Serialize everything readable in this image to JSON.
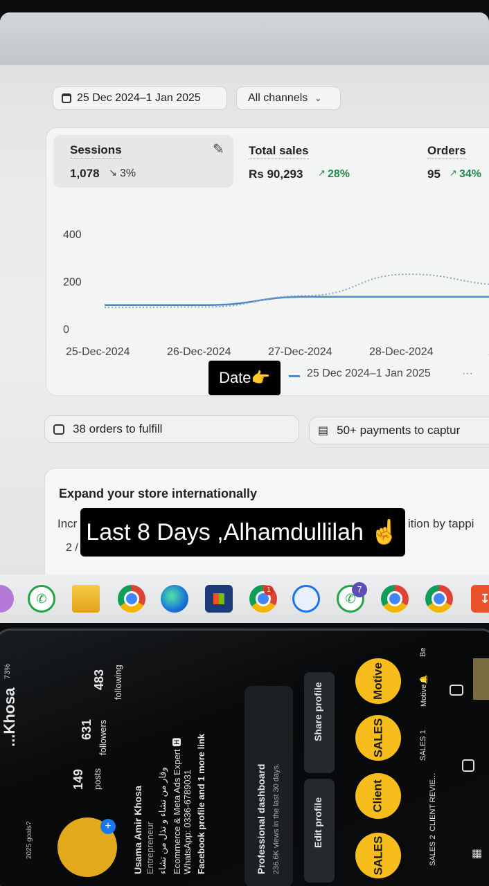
{
  "dashboard": {
    "date_range": "25 Dec 2024–1 Jan 2025",
    "channel_filter": "All channels",
    "metrics": [
      {
        "title": "Sessions",
        "value": "1,078",
        "delta": "3%",
        "direction": "down"
      },
      {
        "title": "Total sales",
        "value": "Rs 90,293",
        "delta": "28%",
        "direction": "up"
      },
      {
        "title": "Orders",
        "value": "95",
        "delta": "34%",
        "direction": "up"
      }
    ],
    "legend_label": "25 Dec 2024–1 Jan 2025",
    "tasks": [
      {
        "label": "38 orders to fulfill",
        "icon": "inbox-icon"
      },
      {
        "label": "50+ payments to captur",
        "icon": "payment-icon"
      }
    ],
    "promo": {
      "title": "Expand your store internationally",
      "body_start": "Incr",
      "body_end": "ition by tappi",
      "counter": "2 /"
    }
  },
  "chart_data": {
    "type": "line",
    "x": [
      "25-Dec-2024",
      "26-Dec-2024",
      "27-Dec-2024",
      "28-Dec-2024",
      "29-"
    ],
    "yticks": [
      0,
      200,
      400
    ],
    "ylim": [
      0,
      400
    ],
    "series": [
      {
        "values": [
          100,
          100,
          135,
          135,
          135
        ],
        "style": "solid",
        "color": "#4a8cc9"
      },
      {
        "values": [
          90,
          92,
          140,
          230,
          185
        ],
        "style": "dotted",
        "color": "#8fa3b8"
      }
    ]
  },
  "stickers": {
    "date_note": "Date👉",
    "caption": "Last 8 Days ,Alhamdullilah ☝️"
  },
  "taskbar": {
    "badge_chrome": "1",
    "badge_whatsapp": "7"
  },
  "phone": {
    "battery": "73%",
    "username": "...Khosa",
    "stats": [
      {
        "value": "149",
        "label": "posts"
      },
      {
        "value": "631",
        "label": "followers"
      },
      {
        "value": "483",
        "label": "following"
      }
    ],
    "avatar_note": "2025 goals?",
    "bio_name": "Usama Amir Khosa",
    "bio_role": "Entrepreneur",
    "bio_urdu": "وقار من تشاء و تذل من تشاء",
    "bio_expertise": "Ecommerce & Meta Ads Expert 🅷",
    "bio_whatsapp": "WhatsApp: 0336-6789031",
    "bio_link": "Facebook profile and 1 more link",
    "dashboard_title": "Professional dashboard",
    "dashboard_sub": "236.6K views in the last 30 days.",
    "edit_profile": "Edit profile",
    "share_profile": "Share profile",
    "highlights": [
      {
        "cover": "SALES",
        "label": "SALES 2"
      },
      {
        "cover": "Client",
        "label": "CLIENT REVIE..."
      },
      {
        "cover": "SALES",
        "label": "SALES 1"
      },
      {
        "cover": "Motive",
        "label": "Motive🔔"
      }
    ],
    "be_label": "Be"
  }
}
